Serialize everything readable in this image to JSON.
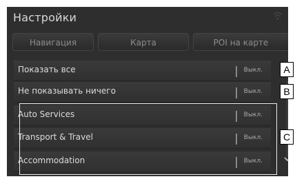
{
  "screen": {
    "title": "Настройки"
  },
  "tabs": [
    {
      "label": "Навигация"
    },
    {
      "label": "Карта"
    },
    {
      "label": "POI на карте"
    }
  ],
  "rows": [
    {
      "label": "Показать все",
      "value": "Выкл."
    },
    {
      "label": "Не показывать ничего",
      "value": "Выкл."
    },
    {
      "label": "Auto Services",
      "value": "Выкл."
    },
    {
      "label": "Transport & Travel",
      "value": "Выкл."
    },
    {
      "label": "Accommodation",
      "value": "Выкл."
    }
  ],
  "callouts": {
    "a": "A",
    "b": "B",
    "c": "C"
  },
  "colors": {
    "background": "#2e2e2e",
    "text": "#dcdcdc",
    "tab_text": "#8d8d8d"
  },
  "icons": {
    "status": "wifi-icon",
    "scroll": "chevron-down-icon"
  }
}
